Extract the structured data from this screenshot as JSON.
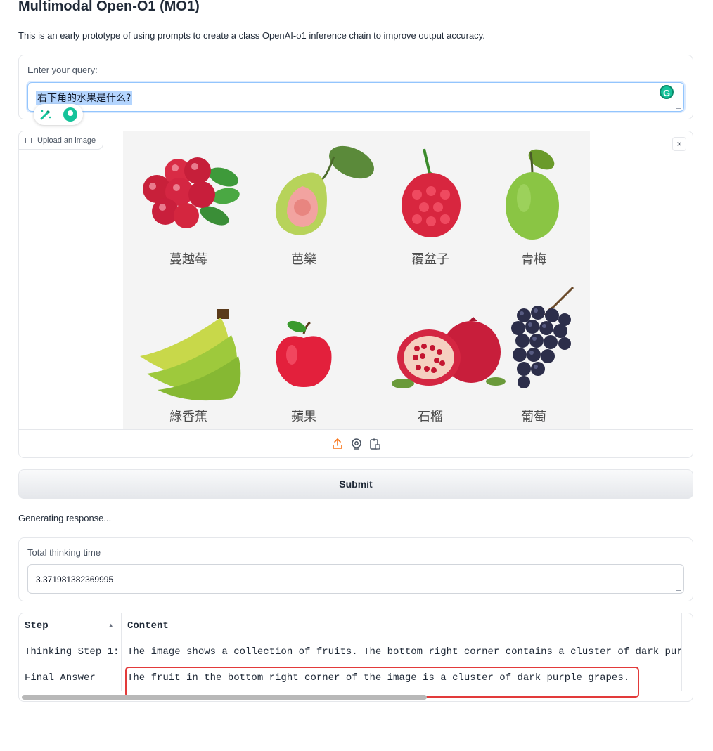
{
  "page": {
    "title": "Multimodal Open-O1 (MO1)",
    "subtitle": "This is an early prototype of using prompts to create a class OpenAI-o1 inference chain to improve output accuracy."
  },
  "query": {
    "label": "Enter your query:",
    "value": "右下角的水果是什么?"
  },
  "image_input": {
    "label": "Upload an image",
    "close_symbol": "×",
    "fruit_labels": [
      "蔓越莓",
      "芭樂",
      "覆盆子",
      "青梅",
      "綠香蕉",
      "蘋果",
      "石榴",
      "葡萄"
    ],
    "toolbar_icons": [
      "upload-icon",
      "webcam-icon",
      "clipboard-icon"
    ]
  },
  "submit": {
    "label": "Submit"
  },
  "status": {
    "text": "Generating response..."
  },
  "thinking_time": {
    "label": "Total thinking time",
    "value": "3.371981382369995"
  },
  "table": {
    "headers": [
      "Step",
      "Content"
    ],
    "rows": [
      [
        "Thinking Step 1:",
        "The image shows a collection of fruits. The bottom right corner contains a cluster of dark pur"
      ],
      [
        "Final Answer",
        "The fruit in the bottom right corner of the image is a cluster of dark purple grapes."
      ]
    ]
  },
  "colors": {
    "accent_upload": "#f97316",
    "highlight_border": "#e23a3a",
    "grammarly": "#15c39a",
    "focus_border": "#93c5fd"
  }
}
